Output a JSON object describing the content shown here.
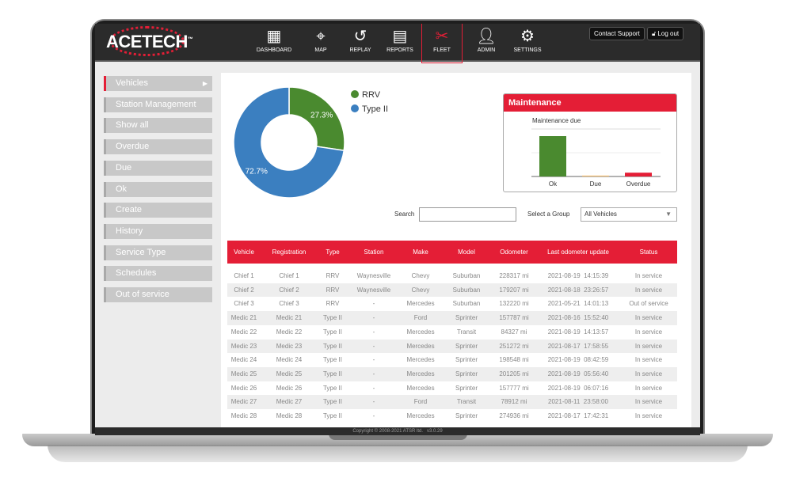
{
  "brand": {
    "name": "ACETECH",
    "tm": "™"
  },
  "nav": [
    {
      "label": "DASHBOARD",
      "icon": "dashboard-icon"
    },
    {
      "label": "MAP",
      "icon": "map-icon"
    },
    {
      "label": "REPLAY",
      "icon": "replay-icon"
    },
    {
      "label": "REPORTS",
      "icon": "reports-icon"
    },
    {
      "label": "FLEET",
      "icon": "fleet-icon",
      "active": true
    },
    {
      "label": "ADMIN",
      "icon": "admin-icon"
    },
    {
      "label": "SETTINGS",
      "icon": "gear-icon"
    }
  ],
  "header": {
    "contact": "Contact Support",
    "logout": "Log out"
  },
  "sidebar": [
    "Vehicles",
    "Station Management",
    "Show all",
    "Overdue",
    "Due",
    "Ok",
    "Create",
    "History",
    "Service Type",
    "Schedules",
    "Out of service"
  ],
  "chart_data": [
    {
      "type": "pie",
      "donut": true,
      "labels": [
        "RRV",
        "Type II"
      ],
      "values": [
        27.3,
        72.7
      ],
      "data_labels": [
        "27.3%",
        "72.7%"
      ],
      "colors": [
        "#4a8a2f",
        "#3b7fc0"
      ],
      "legend": "right"
    },
    {
      "type": "bar",
      "title": "Maintenance due",
      "categories": [
        "Ok",
        "Due",
        "Overdue"
      ],
      "values": [
        17,
        0.4,
        1.6
      ],
      "ylim": [
        0,
        20
      ],
      "colors": [
        "#4a8a2f",
        "#f5c27a",
        "#e41e36"
      ],
      "grid": true
    }
  ],
  "maintenance": {
    "title": "Maintenance"
  },
  "filters": {
    "search_label": "Search",
    "search_value": "",
    "group_label": "Select a Group",
    "group_value": "All Vehicles"
  },
  "table": {
    "headers": [
      "Vehicle",
      "Registration",
      "Type",
      "Station",
      "Make",
      "Model",
      "Odometer",
      "Last odometer update",
      "Status"
    ],
    "rows": [
      [
        "Chief 1",
        "Chief 1",
        "RRV",
        "Waynesville",
        "Chevy",
        "Suburban",
        "228317 mi",
        "2021-08-19  14:15:39",
        "In service"
      ],
      [
        "Chief 2",
        "Chief 2",
        "RRV",
        "Waynesville",
        "Chevy",
        "Suburban",
        "179207 mi",
        "2021-08-18  23:26:57",
        "In service"
      ],
      [
        "Chief 3",
        "Chief 3",
        "RRV",
        "-",
        "Mercedes",
        "Suburban",
        "132220 mi",
        "2021-05-21  14:01:13",
        "Out of service"
      ],
      [
        "Medic 21",
        "Medic 21",
        "Type II",
        "-",
        "Ford",
        "Sprinter",
        "157787 mi",
        "2021-08-16  15:52:40",
        "In service"
      ],
      [
        "Medic 22",
        "Medic 22",
        "Type II",
        "-",
        "Mercedes",
        "Transit",
        "84327 mi",
        "2021-08-19  14:13:57",
        "In service"
      ],
      [
        "Medic 23",
        "Medic 23",
        "Type II",
        "-",
        "Mercedes",
        "Sprinter",
        "251272 mi",
        "2021-08-17  17:58:55",
        "In service"
      ],
      [
        "Medic 24",
        "Medic 24",
        "Type II",
        "-",
        "Mercedes",
        "Sprinter",
        "198548 mi",
        "2021-08-19  08:42:59",
        "In service"
      ],
      [
        "Medic 25",
        "Medic 25",
        "Type II",
        "-",
        "Mercedes",
        "Sprinter",
        "201205 mi",
        "2021-08-19  05:56:40",
        "In service"
      ],
      [
        "Medic 26",
        "Medic 26",
        "Type II",
        "-",
        "Mercedes",
        "Sprinter",
        "157777 mi",
        "2021-08-19  06:07:16",
        "In service"
      ],
      [
        "Medic 27",
        "Medic 27",
        "Type II",
        "-",
        "Ford",
        "Transit",
        "78912 mi",
        "2021-08-11  23:58:00",
        "In service"
      ],
      [
        "Medic 28",
        "Medic 28",
        "Type II",
        "-",
        "Mercedes",
        "Sprinter",
        "274936 mi",
        "2021-08-17  17:42:31",
        "In service"
      ]
    ]
  },
  "footer": "Copyright © 2008-2021 ATSR ltd.   v3.0.29"
}
